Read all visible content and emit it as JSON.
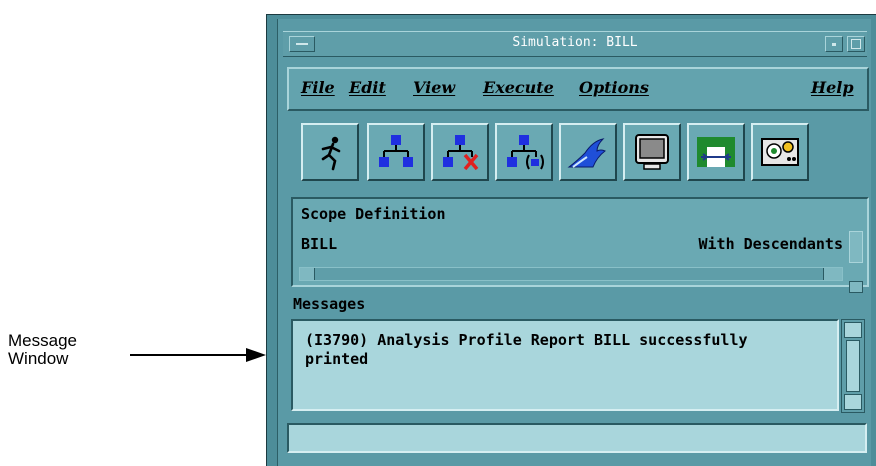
{
  "annotation": {
    "line1": "Message",
    "line2": "Window"
  },
  "window": {
    "title": "Simulation: BILL"
  },
  "menu": {
    "file": "File",
    "edit": "Edit",
    "view": "View",
    "execute": "Execute",
    "options": "Options",
    "help": "Help"
  },
  "toolbar": {
    "tools": [
      {
        "icon": "running-man-icon"
      },
      {
        "icon": "hierarchy-icon"
      },
      {
        "icon": "hierarchy-delete-icon"
      },
      {
        "icon": "hierarchy-paren-icon"
      },
      {
        "icon": "wave-icon"
      },
      {
        "icon": "monitor-icon"
      },
      {
        "icon": "panel-arrows-icon"
      },
      {
        "icon": "instrument-icon"
      }
    ]
  },
  "scope": {
    "title": "Scope Definition",
    "name": "BILL",
    "mode": "With Descendants"
  },
  "messages": {
    "label": "Messages",
    "text": "(I3790) Analysis Profile Report BILL successfully\nprinted"
  },
  "status": {
    "text": ""
  },
  "colors": {
    "window_bg": "#5a9aa6",
    "message_bg": "#a9d6dc",
    "icon_blue": "#1f2fe0",
    "icon_red": "#e0201f",
    "icon_green": "#1f8a2e"
  }
}
